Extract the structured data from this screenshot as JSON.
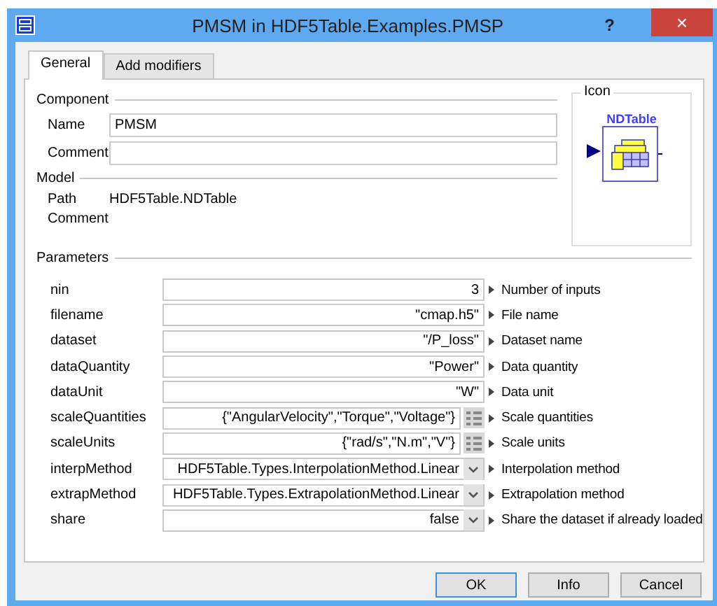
{
  "window": {
    "title": "PMSM in HDF5Table.Examples.PMSP",
    "help": "?",
    "close": "×"
  },
  "tabs": [
    {
      "label": "General",
      "selected": true
    },
    {
      "label": "Add modifiers",
      "selected": false
    }
  ],
  "component": {
    "heading": "Component",
    "name_label": "Name",
    "name_value": "PMSM",
    "comment_label": "Comment"
  },
  "icon": {
    "heading": "Icon",
    "label": "NDTable"
  },
  "model": {
    "heading": "Model",
    "path_label": "Path",
    "path_value": "HDF5Table.NDTable",
    "comment_label": "Comment"
  },
  "parameters": {
    "heading": "Parameters",
    "rows": [
      {
        "name": "nin",
        "kind": "text",
        "value": "3",
        "description": "Number of inputs"
      },
      {
        "name": "filename",
        "kind": "text",
        "value": "\"cmap.h5\"",
        "description": "File name"
      },
      {
        "name": "dataset",
        "kind": "text",
        "value": "\"/P_loss\"",
        "description": "Dataset name"
      },
      {
        "name": "dataQuantity",
        "kind": "text",
        "value": "\"Power\"",
        "description": "Data quantity"
      },
      {
        "name": "dataUnit",
        "kind": "text",
        "value": "\"W\"",
        "description": "Data unit"
      },
      {
        "name": "scaleQuantities",
        "kind": "list",
        "value": "{\"AngularVelocity\",\"Torque\",\"Voltage\"}",
        "description": "Scale quantities"
      },
      {
        "name": "scaleUnits",
        "kind": "list",
        "value": "{\"rad/s\",\"N.m\",\"V\"}",
        "description": "Scale units"
      },
      {
        "name": "interpMethod",
        "kind": "choice",
        "value": "HDF5Table.Types.InterpolationMethod.Linear",
        "description": "Interpolation method"
      },
      {
        "name": "extrapMethod",
        "kind": "choice",
        "value": "HDF5Table.Types.ExtrapolationMethod.Linear",
        "description": "Extrapolation method"
      },
      {
        "name": "share",
        "kind": "choice",
        "value": "false",
        "description": "Share the dataset if already loaded"
      }
    ]
  },
  "buttons": [
    {
      "label": "OK",
      "default": true
    },
    {
      "label": "Info",
      "default": false
    },
    {
      "label": "Cancel",
      "default": false
    }
  ]
}
